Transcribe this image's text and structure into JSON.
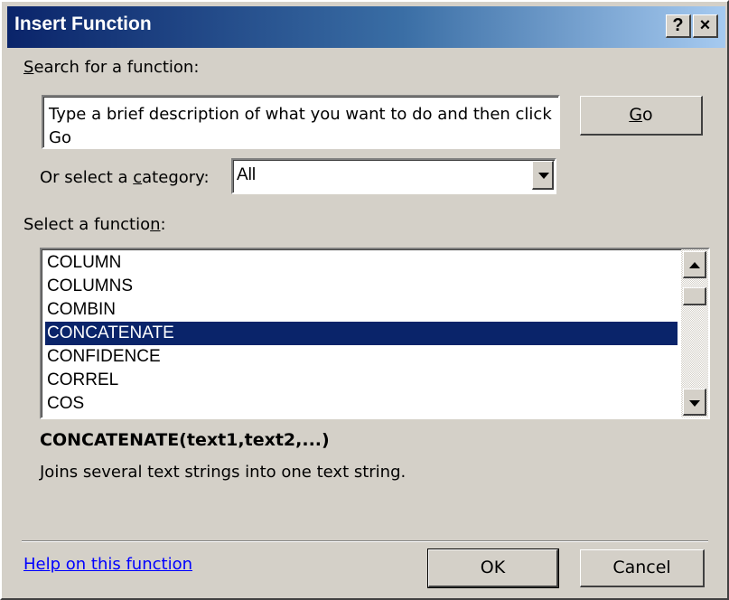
{
  "window": {
    "title": "Insert Function",
    "help_button": "?",
    "close_button": "×"
  },
  "search": {
    "label_prefix": "",
    "label_accel": "S",
    "label_rest": "earch for a function:",
    "value": "Type a brief description of what you want to do and then click Go",
    "go_label_accel": "G",
    "go_label_rest": "o"
  },
  "category": {
    "label_before": "Or select a ",
    "label_accel": "c",
    "label_after": "ategory:",
    "selected": "All"
  },
  "functions": {
    "label_before": "Select a functio",
    "label_accel": "n",
    "label_after": ":",
    "items": [
      "COLUMN",
      "COLUMNS",
      "COMBIN",
      "CONCATENATE",
      "CONFIDENCE",
      "CORREL",
      "COS"
    ],
    "selected_index": 3
  },
  "details": {
    "signature": "CONCATENATE(text1,text2,...)",
    "description": "Joins several text strings into one text string."
  },
  "footer": {
    "help_link": "Help on this function",
    "ok_label": "OK",
    "cancel_label": "Cancel"
  }
}
